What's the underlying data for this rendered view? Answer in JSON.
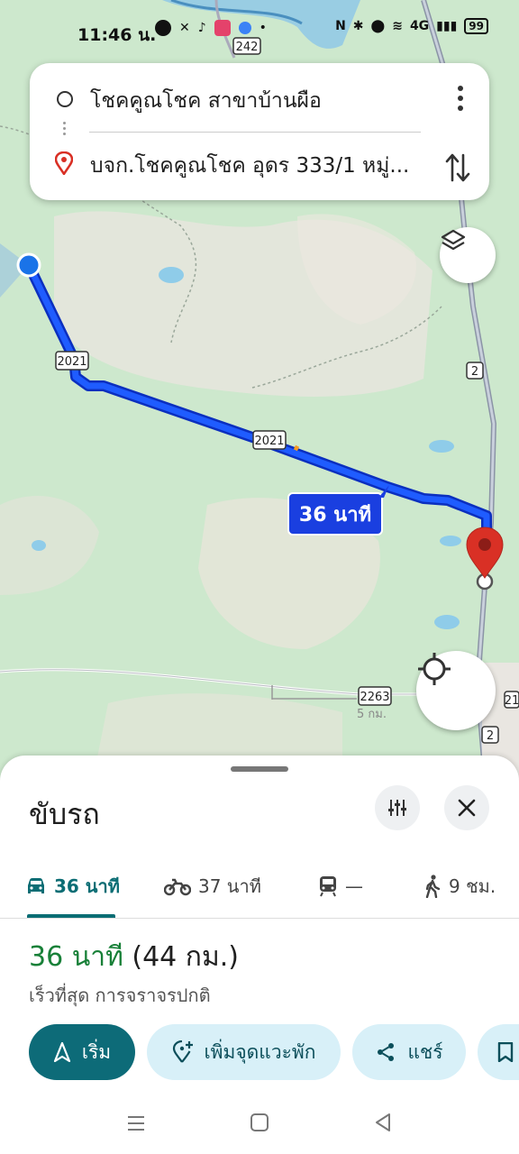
{
  "status_bar": {
    "time": "11:46 น.",
    "network": "4G",
    "battery": "99"
  },
  "route": {
    "origin": "โชคคูณโชค สาขาบ้านผือ",
    "destination": "บจก.โชคคูณโชค อุดร 333/1 หมู่..."
  },
  "map": {
    "route_duration_label": "36 นาที",
    "road_labels": [
      "242",
      "2021",
      "2021",
      "2",
      "2263",
      "2",
      "2",
      "21"
    ],
    "scale_label": "5 กม."
  },
  "sheet": {
    "title": "ขับรถ",
    "modes": [
      {
        "icon": "car-icon",
        "label": "36 นาที",
        "active": true
      },
      {
        "icon": "motorcycle-icon",
        "label": "37 นาที",
        "active": false
      },
      {
        "icon": "train-icon",
        "label": "—",
        "active": false
      },
      {
        "icon": "walk-icon",
        "label": "9 ชม.",
        "active": false
      }
    ],
    "summary_time": "36 นาที",
    "summary_distance": "(44 กม.)",
    "summary_sub": "เร็วที่สุด การจราจรปกติ",
    "actions": {
      "start": "เริ่ม",
      "add_stop": "เพิ่มจุดแวะพัก",
      "share": "แชร์"
    }
  },
  "colors": {
    "route_blue": "#1a3fe0",
    "accent_teal": "#0d6b78",
    "time_green": "#188038",
    "pin_red": "#d93025"
  }
}
